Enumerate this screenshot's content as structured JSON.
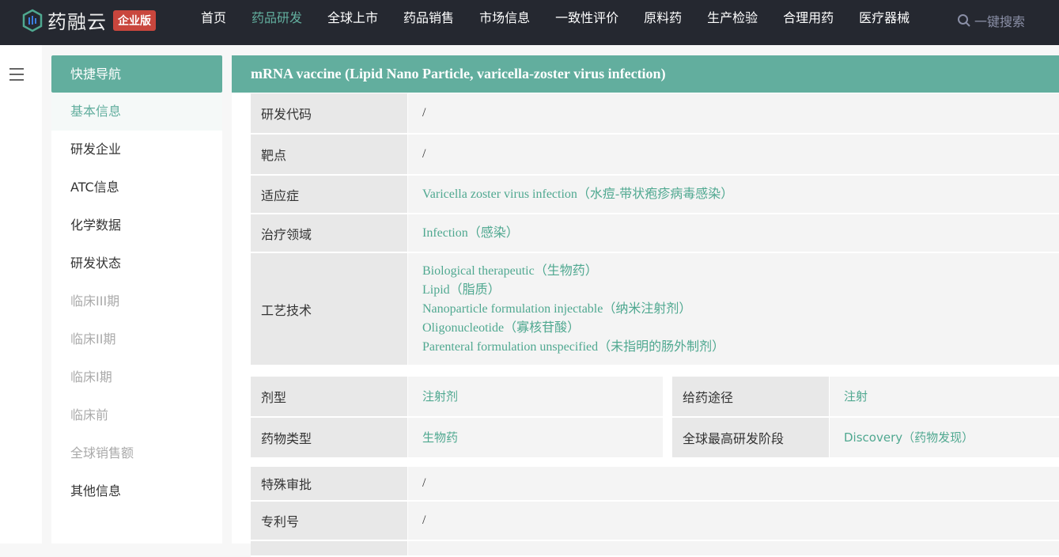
{
  "header": {
    "logo": "药融云",
    "badge": "企业版",
    "nav": [
      "首页",
      "药品研发",
      "全球上市",
      "药品销售",
      "市场信息",
      "一致性评价",
      "原料药",
      "生产检验",
      "合理用药",
      "医疗器械"
    ],
    "active_nav": 1,
    "search": "一键搜索"
  },
  "sidebar": {
    "title": "快捷导航",
    "items": [
      {
        "label": "基本信息",
        "state": "active"
      },
      {
        "label": "研发企业",
        "state": "normal"
      },
      {
        "label": "ATC信息",
        "state": "normal"
      },
      {
        "label": "化学数据",
        "state": "normal"
      },
      {
        "label": "研发状态",
        "state": "normal"
      },
      {
        "label": "临床III期",
        "state": "dim"
      },
      {
        "label": "临床II期",
        "state": "dim"
      },
      {
        "label": "临床I期",
        "state": "dim"
      },
      {
        "label": "临床前",
        "state": "dim"
      },
      {
        "label": "全球销售额",
        "state": "dim"
      },
      {
        "label": "其他信息",
        "state": "normal"
      }
    ]
  },
  "main": {
    "title": "mRNA vaccine (Lipid Nano Particle, varicella-zoster virus infection)",
    "rows": [
      {
        "label": "研发代码",
        "values": [
          "/"
        ]
      },
      {
        "label": "靶点",
        "values": [
          "/"
        ]
      },
      {
        "label": "适应症",
        "values": [
          "Varicella zoster virus infection（水痘-带状疱疹病毒感染）"
        ],
        "link": true
      },
      {
        "label": "治疗领域",
        "values": [
          "Infection（感染）"
        ],
        "link": true
      },
      {
        "label": "工艺技术",
        "values": [
          "Biological therapeutic（生物药）",
          "Lipid（脂质）",
          "Nanoparticle formulation injectable（纳米注射剂）",
          "Oligonucleotide（寡核苷酸）",
          "Parenteral formulation unspecified（未指明的肠外制剂）"
        ],
        "link": true
      }
    ],
    "grid": [
      {
        "label": "剂型",
        "value": "注射剂"
      },
      {
        "label": "给药途径",
        "value": "注射"
      },
      {
        "label": "药物类型",
        "value": "生物药"
      },
      {
        "label": "全球最高研发阶段",
        "value": "Discovery（药物发现）"
      }
    ],
    "rows2": [
      {
        "label": "特殊审批",
        "value": "/"
      },
      {
        "label": "专利号",
        "value": "/"
      }
    ]
  },
  "colors": {
    "accent": "#62ae9e",
    "header": "#252830",
    "badge": "#c9463d"
  }
}
